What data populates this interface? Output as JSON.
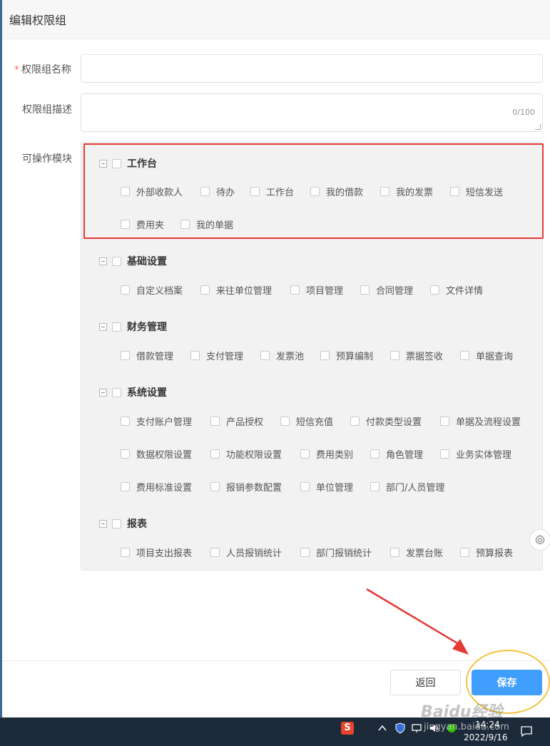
{
  "dialog": {
    "title": "编辑权限组"
  },
  "form": {
    "name_label": "权限组名称",
    "required_mark": "*",
    "name_value": "",
    "desc_label": "权限组描述",
    "desc_value": "",
    "desc_counter": "0/100",
    "modules_label": "可操作模块"
  },
  "groups": [
    {
      "title": "工作台",
      "items": [
        "外部收款人",
        "待办",
        "工作台",
        "我的借款",
        "我的发票",
        "短信发送",
        "费用夹",
        "我的单据"
      ]
    },
    {
      "title": "基础设置",
      "items": [
        "自定义档案",
        "来往单位管理",
        "项目管理",
        "合同管理",
        "文件详情"
      ]
    },
    {
      "title": "财务管理",
      "items": [
        "借款管理",
        "支付管理",
        "发票池",
        "预算编制",
        "票据签收",
        "单据查询"
      ]
    },
    {
      "title": "系统设置",
      "items": [
        "支付账户管理",
        "产品授权",
        "短信充值",
        "付款类型设置",
        "单据及流程设置",
        "数据权限设置",
        "功能权限设置",
        "费用类别",
        "角色管理",
        "业务实体管理",
        "费用标准设置",
        "报销参数配置",
        "单位管理",
        "部门/人员管理"
      ]
    },
    {
      "title": "报表",
      "items": [
        "项目支出报表",
        "人员报销统计",
        "部门报销统计",
        "发票台账",
        "预算报表"
      ]
    }
  ],
  "footer": {
    "back_label": "返回",
    "save_label": "保存"
  },
  "taskbar": {
    "time": "14:24",
    "date": "2022/9/16",
    "ime": "S"
  },
  "watermark": {
    "brand": "Baidu经验",
    "url": "jingyan.baidu.com"
  },
  "colors": {
    "primary": "#409eff",
    "annotation_red": "#e53935",
    "annotation_yellow": "#f5c242"
  }
}
